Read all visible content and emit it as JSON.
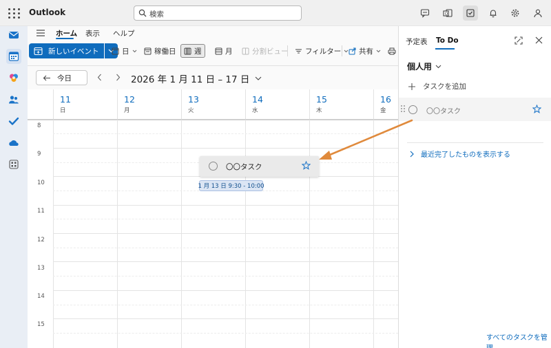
{
  "app": {
    "title": "Outlook"
  },
  "search": {
    "placeholder": "検索"
  },
  "topbar_icons": [
    "chat-icon",
    "outlook-app-icon",
    "todo-icon",
    "bell-icon",
    "gear-icon",
    "person-icon"
  ],
  "rail_icons": [
    "mail-icon",
    "calendar-icon",
    "copilot-icon",
    "people-icon",
    "todo-check-icon",
    "onedrive-icon",
    "apps-icon"
  ],
  "ribbon": {
    "tabs": [
      "ホーム",
      "表示",
      "ヘルプ"
    ],
    "new_event": "新しいイベント",
    "day": "日",
    "workweek": "稼働日",
    "week": "週",
    "month": "月",
    "split_view": "分割ビュー",
    "filter": "フィルター",
    "share": "共有"
  },
  "datebar": {
    "today": "今日",
    "range": "2026 年 1 月 11 日 – 17 日"
  },
  "calendar": {
    "days": [
      {
        "num": "11",
        "weekday": "日"
      },
      {
        "num": "12",
        "weekday": "月"
      },
      {
        "num": "13",
        "weekday": "火"
      },
      {
        "num": "14",
        "weekday": "水"
      },
      {
        "num": "15",
        "weekday": "木"
      },
      {
        "num": "16",
        "weekday": "金"
      }
    ],
    "hours": [
      "8",
      "9",
      "10",
      "11",
      "12",
      "13",
      "14",
      "15"
    ]
  },
  "drag": {
    "task_name": "〇〇タスク",
    "time_tip": "1 月 13 日 9:30 - 10:00"
  },
  "todo_panel": {
    "tabs": [
      "予定表",
      "To Do"
    ],
    "list_title": "個人用",
    "add_task": "タスクを追加",
    "task_name": "〇〇タスク",
    "show_completed": "最近完了したものを表示する",
    "manage_tasks": "すべてのタスクを管理"
  },
  "colors": {
    "accent": "#0f6cbd",
    "arrow": "#e08a3c"
  }
}
